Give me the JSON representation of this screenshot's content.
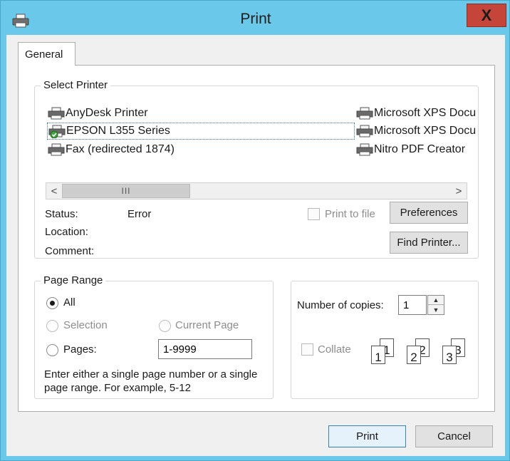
{
  "window": {
    "title": "Print",
    "close_symbol": "X",
    "icon": "printer-icon"
  },
  "tabs": [
    {
      "label": "General",
      "active": true
    }
  ],
  "select_printer": {
    "group_title": "Select Printer",
    "printers": [
      {
        "name": "AnyDesk Printer",
        "icon": "printer-icon"
      },
      {
        "name": "EPSON L355 Series",
        "icon": "printer-default-icon",
        "selected": true,
        "default": true
      },
      {
        "name": "Fax (redirected 1874)",
        "icon": "fax-icon"
      },
      {
        "name": "Microsoft XPS Document Writer",
        "icon": "printer-icon"
      },
      {
        "name": "Microsoft XPS Document Writer",
        "icon": "printer-icon"
      },
      {
        "name": "Nitro PDF Creator",
        "icon": "printer-icon"
      }
    ],
    "scroll_left": "<",
    "scroll_right": ">",
    "scroll_grip": "III",
    "status_label": "Status:",
    "status_value": "Error",
    "location_label": "Location:",
    "location_value": "",
    "comment_label": "Comment:",
    "comment_value": "",
    "print_to_file_label": "Print to file",
    "print_to_file_checked": false,
    "preferences_label": "Preferences",
    "find_printer_label": "Find Printer..."
  },
  "page_range": {
    "group_title": "Page Range",
    "all_label": "All",
    "selection_label": "Selection",
    "current_page_label": "Current Page",
    "pages_label": "Pages:",
    "pages_value": "1-9999",
    "selected_option": "All",
    "hint": "Enter either a single page number or a single page range.  For example, 5-12"
  },
  "copies": {
    "label": "Number of copies:",
    "value": "1",
    "collate_label": "Collate",
    "collate_checked": false,
    "collate_pages": [
      "1",
      "1",
      "2",
      "2",
      "3",
      "3"
    ]
  },
  "actions": {
    "print_label": "Print",
    "cancel_label": "Cancel"
  },
  "colors": {
    "title_bar": "#6ac8ea",
    "close_button": "#c5453a",
    "dialog_background": "#f0f0f0"
  }
}
